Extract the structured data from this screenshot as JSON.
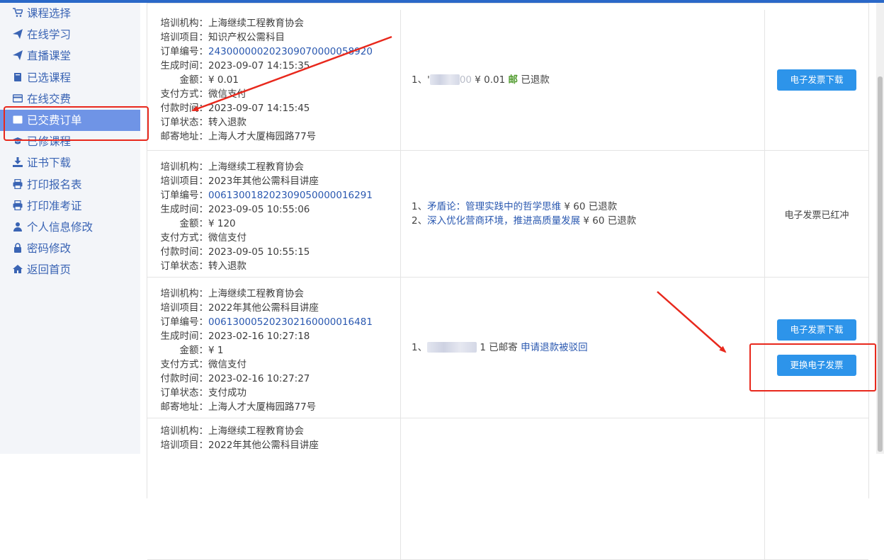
{
  "sidebar": {
    "items": [
      {
        "label": "课程选择",
        "icon": "cart-icon",
        "name": "sidebar-item-course-select"
      },
      {
        "label": "在线学习",
        "icon": "send-icon",
        "name": "sidebar-item-online-learning"
      },
      {
        "label": "直播课堂",
        "icon": "send-icon",
        "name": "sidebar-item-live-class"
      },
      {
        "label": "已选课程",
        "icon": "book-icon",
        "name": "sidebar-item-selected-courses"
      },
      {
        "label": "在线交费",
        "icon": "credit-card-icon",
        "name": "sidebar-item-online-payment"
      },
      {
        "label": "已交费订单",
        "icon": "list-icon",
        "name": "sidebar-item-paid-orders",
        "active": true
      },
      {
        "label": "已修课程",
        "icon": "graduation-cap-icon",
        "name": "sidebar-item-completed-courses"
      },
      {
        "label": "证书下载",
        "icon": "download-icon",
        "name": "sidebar-item-certificate-download"
      },
      {
        "label": "打印报名表",
        "icon": "printer-icon",
        "name": "sidebar-item-print-registration"
      },
      {
        "label": "打印准考证",
        "icon": "printer-icon",
        "name": "sidebar-item-print-admission"
      },
      {
        "label": "个人信息修改",
        "icon": "user-icon",
        "name": "sidebar-item-profile-edit"
      },
      {
        "label": "密码修改",
        "icon": "lock-icon",
        "name": "sidebar-item-password"
      },
      {
        "label": "返回首页",
        "icon": "home-icon",
        "name": "sidebar-item-home"
      }
    ]
  },
  "labels": {
    "org": "培训机构：",
    "project": "培训项目：",
    "order_no": "订单编号：",
    "created": "生成时间：",
    "amount": "金额：",
    "pay_method": "支付方式：",
    "pay_time": "付款时间：",
    "status": "订单状态：",
    "address": "邮寄地址："
  },
  "orders": [
    {
      "org": "上海继续工程教育协会",
      "project": "知识产权公需科目",
      "order_no": "243000000202309070000058920",
      "created": "2023-09-07 14:15:35",
      "amount": "¥ 0.01",
      "pay_method": "微信支付",
      "pay_time": "2023-09-07 14:15:45",
      "status": "转入退款",
      "address": "上海人才大厦梅园路77号",
      "item_prefix": "1、",
      "item_partial": "'",
      "item_partial_2": "00",
      "item_price": "¥ 0.01",
      "item_mail": "邮",
      "item_status": "已退款",
      "button_1": "电子发票下载"
    },
    {
      "org": "上海继续工程教育协会",
      "project": "2023年其他公需科目讲座",
      "order_no": "006130018202309050000016291",
      "created": "2023-09-05 10:55:06",
      "amount": "¥ 120",
      "pay_method": "微信支付",
      "pay_time": "2023-09-05 10:55:15",
      "status": "转入退款",
      "items": [
        {
          "prefix": "1、",
          "title": "矛盾论：管理实践中的哲学思维",
          "price": "¥ 60",
          "status": "已退款"
        },
        {
          "prefix": "2、",
          "title": "深入优化营商环境，推进高质量发展",
          "price": "¥ 60",
          "status": "已退款"
        }
      ],
      "action_text": "电子发票已红冲"
    },
    {
      "org": "上海继续工程教育协会",
      "project": "2022年其他公需科目讲座",
      "order_no": "006130005202302160000016481",
      "created": "2023-02-16 10:27:18",
      "amount": "¥ 1",
      "pay_method": "微信支付",
      "pay_time": "2023-02-16 10:27:27",
      "status": "支付成功",
      "address": "上海人才大厦梅园路77号",
      "item_prefix": "1、",
      "item_suffix": "1 已邮寄",
      "item_link": "申请退款被驳回",
      "button_1": "电子发票下载",
      "button_2": "更换电子发票"
    },
    {
      "org": "上海继续工程教育协会",
      "project": "2022年其他公需科目讲座"
    }
  ],
  "colors": {
    "accent": "#2a68c8",
    "sidebar_active": "#6f94e6",
    "button": "#2d94ea",
    "link": "#2a58b0",
    "annotation_red": "#e8281c"
  }
}
